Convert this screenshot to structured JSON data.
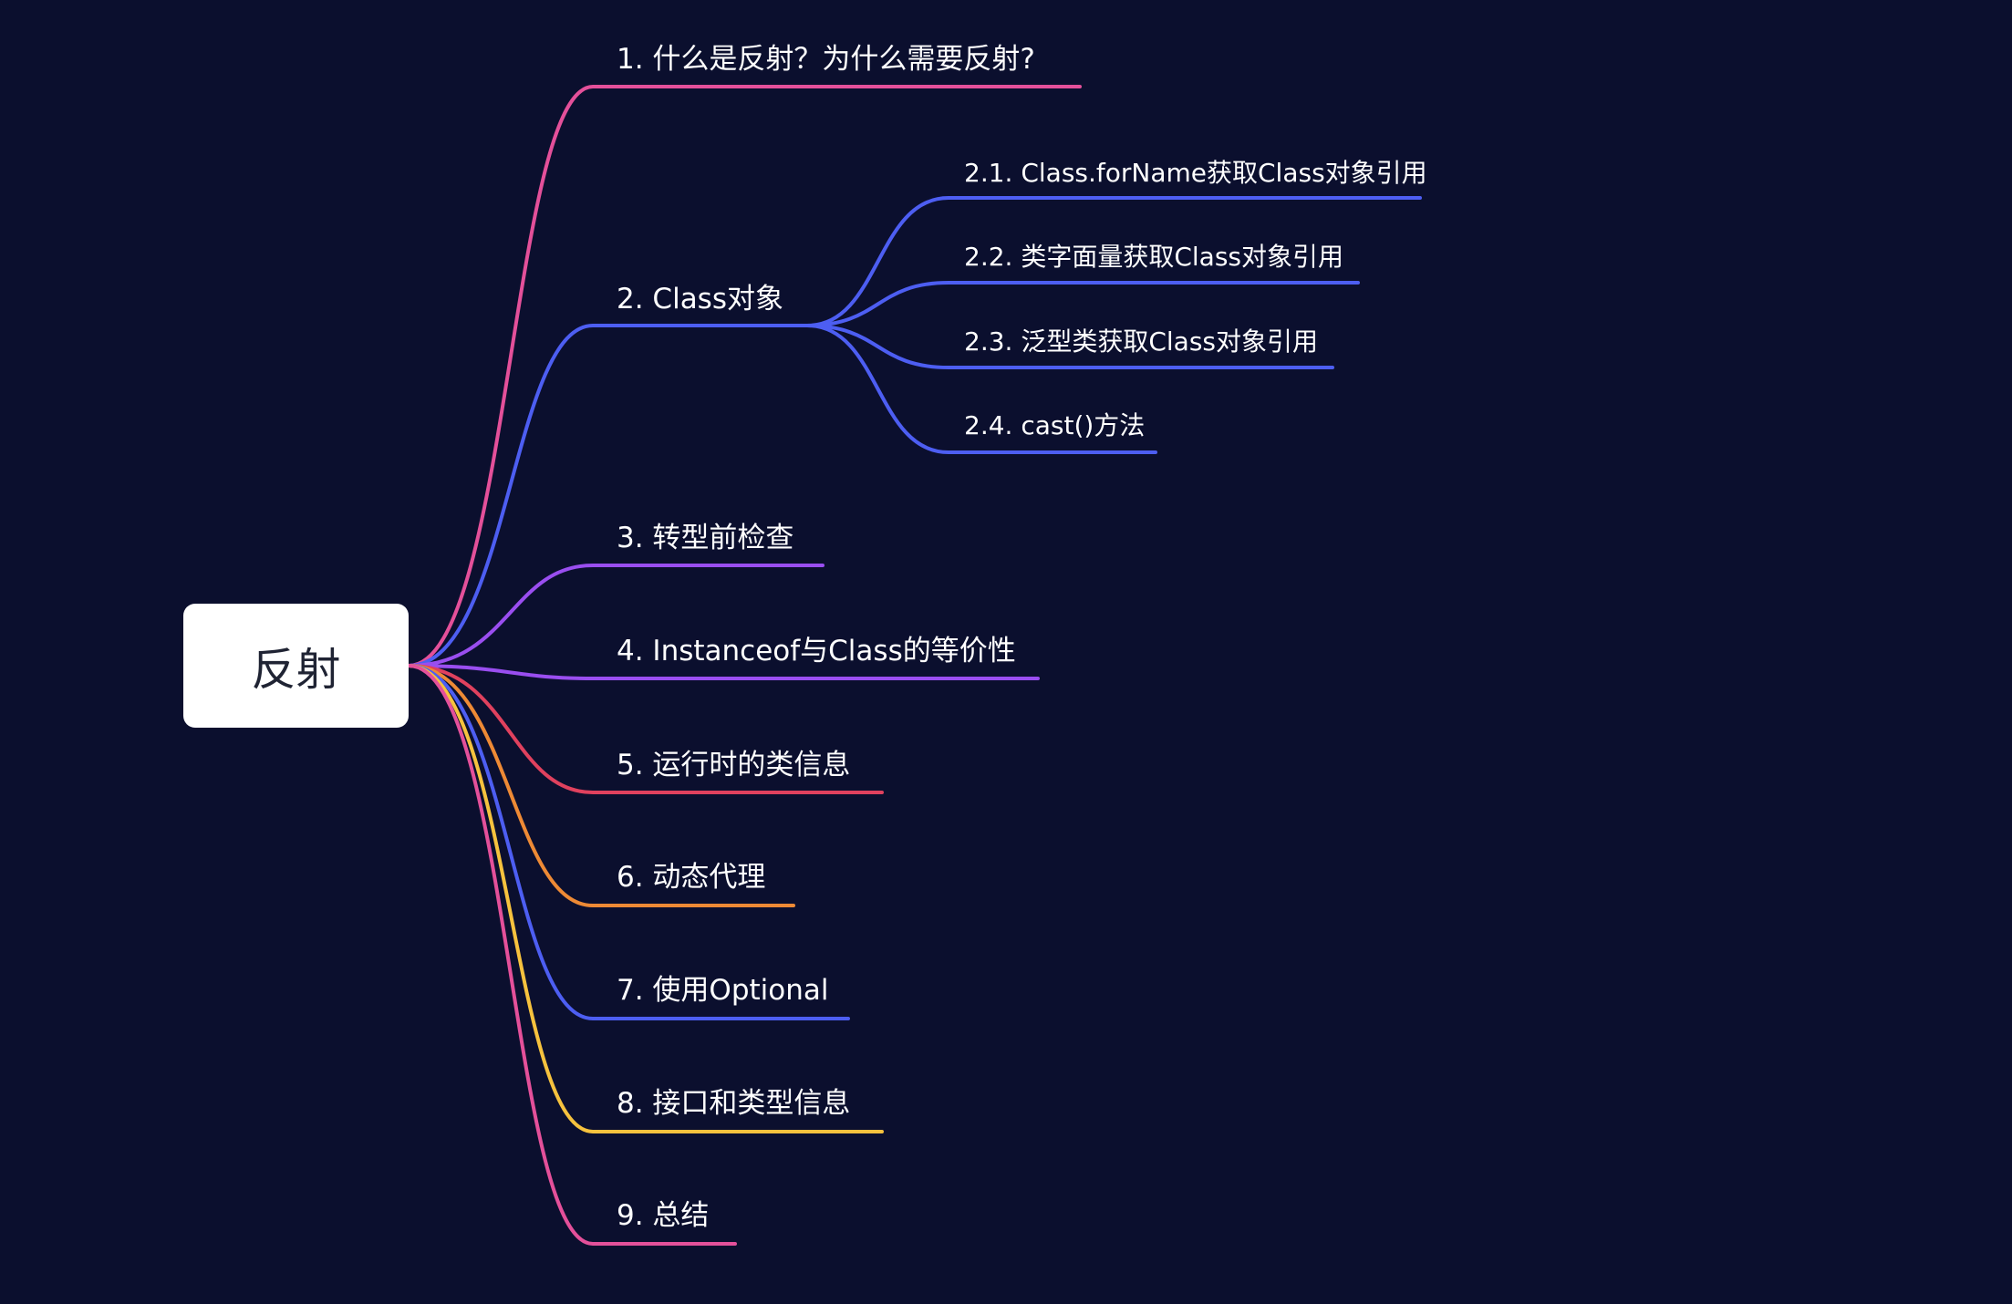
{
  "root": {
    "label": "反射",
    "color": "#ffffff"
  },
  "topics": [
    {
      "id": "t1",
      "label": "1. 什么是反射？为什么需要反射?",
      "color": "#e4509a"
    },
    {
      "id": "t2",
      "label": "2. Class对象",
      "color": "#4d5ef2",
      "children": [
        {
          "id": "t2-1",
          "label": "2.1. Class.forName获取Class对象引用",
          "color": "#4d5ef2"
        },
        {
          "id": "t2-2",
          "label": "2.2. 类字面量获取Class对象引用",
          "color": "#4d5ef2"
        },
        {
          "id": "t2-3",
          "label": "2.3. 泛型类获取Class对象引用",
          "color": "#4d5ef2"
        },
        {
          "id": "t2-4",
          "label": "2.4. cast()方法",
          "color": "#4d5ef2"
        }
      ]
    },
    {
      "id": "t3",
      "label": "3. 转型前检查",
      "color": "#9a4ef0"
    },
    {
      "id": "t4",
      "label": "4. Instanceof与Class的等价性",
      "color": "#9a4ef0"
    },
    {
      "id": "t5",
      "label": "5. 运行时的类信息",
      "color": "#e0415e"
    },
    {
      "id": "t6",
      "label": "6. 动态代理",
      "color": "#ee8a35"
    },
    {
      "id": "t7",
      "label": "7. 使用Optional",
      "color": "#4d5ef2"
    },
    {
      "id": "t8",
      "label": "8. 接口和类型信息",
      "color": "#f6c23e"
    },
    {
      "id": "t9",
      "label": "9. 总结",
      "color": "#e4509a"
    }
  ]
}
